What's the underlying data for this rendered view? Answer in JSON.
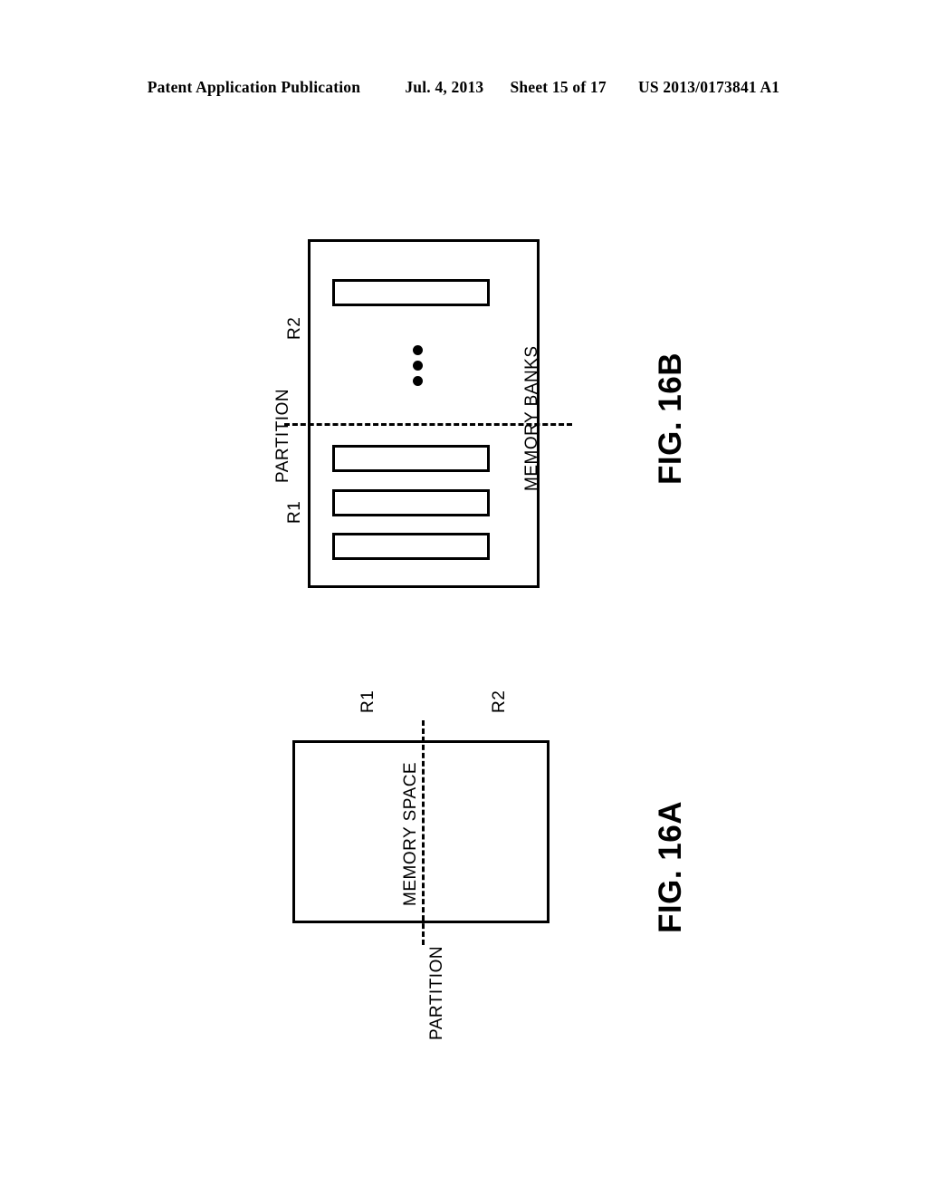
{
  "header": {
    "publication": "Patent Application Publication",
    "date": "Jul. 4, 2013",
    "sheet": "Sheet 15 of 17",
    "pub_number": "US 2013/0173841 A1"
  },
  "figures": [
    {
      "id": "fig16b",
      "caption": "FIG. 16B",
      "container_label": "MEMORY BANKS",
      "partition_label": "PARTITION",
      "region_upper_label": "R2",
      "region_lower_label": "R1",
      "ellipsis_glyph": "vertical-ellipsis",
      "banks": [
        {
          "index": 0,
          "region": "R2"
        },
        {
          "index": 1,
          "region": "R1"
        },
        {
          "index": 2,
          "region": "R1"
        },
        {
          "index": 3,
          "region": "R1"
        }
      ]
    },
    {
      "id": "fig16a",
      "caption": "FIG. 16A",
      "container_label": "MEMORY SPACE",
      "partition_label": "PARTITION",
      "region_left_label": "R1",
      "region_right_label": "R2"
    }
  ],
  "colors": {
    "ink": "#000000",
    "paper": "#ffffff"
  }
}
